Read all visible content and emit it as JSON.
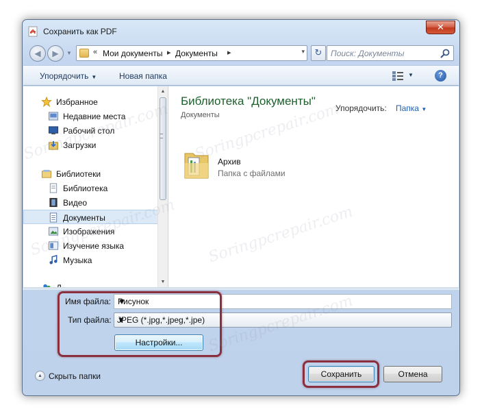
{
  "window": {
    "title": "Сохранить как PDF",
    "close_glyph": "✕"
  },
  "address_bar": {
    "overflow": "«",
    "crumbs": [
      "Мои документы",
      "Документы"
    ],
    "separator": "▸",
    "dropdown": "▾",
    "refresh_glyph": "↻"
  },
  "search": {
    "placeholder": "Поиск: Документы"
  },
  "toolbar": {
    "organize": "Упорядочить",
    "new_folder": "Новая папка",
    "help": "?"
  },
  "nav": {
    "items": [
      {
        "label": "Избранное",
        "icon": "star-icon"
      },
      {
        "label": "Недавние места",
        "icon": "recent-places-icon"
      },
      {
        "label": "Рабочий стол",
        "icon": "desktop-icon"
      },
      {
        "label": "Загрузки",
        "icon": "downloads-icon"
      },
      {
        "label": "Библиотеки",
        "icon": "libraries-icon"
      },
      {
        "label": "Библиотека",
        "icon": "library-icon"
      },
      {
        "label": "Видео",
        "icon": "video-icon"
      },
      {
        "label": "Документы",
        "icon": "documents-icon",
        "selected": true
      },
      {
        "label": "Изображения",
        "icon": "pictures-icon"
      },
      {
        "label": "Изучение языка",
        "icon": "language-library-icon"
      },
      {
        "label": "Музыка",
        "icon": "music-icon"
      },
      {
        "label": "Д",
        "icon": "homegroup-icon"
      }
    ]
  },
  "content": {
    "library_title": "Библиотека \"Документы\"",
    "library_subtitle": "Документы",
    "arrange_label": "Упорядочить:",
    "arrange_value": "Папка",
    "item": {
      "name": "Архив",
      "type": "Папка с файлами"
    }
  },
  "form": {
    "filename_label": "Имя файла:",
    "filename_value": "Рисунок",
    "filetype_label": "Тип файла:",
    "filetype_value": "JPEG (*.jpg,*.jpeg,*.jpe)",
    "settings_button": "Настройки..."
  },
  "footer": {
    "hide_folders": "Скрыть папки",
    "save": "Сохранить",
    "cancel": "Отмена"
  },
  "watermark": "Soringpcrepair.com",
  "colors": {
    "library_title": "#1e5f2d",
    "highlight": "#8a2f3d",
    "link": "#1e5fb3"
  }
}
